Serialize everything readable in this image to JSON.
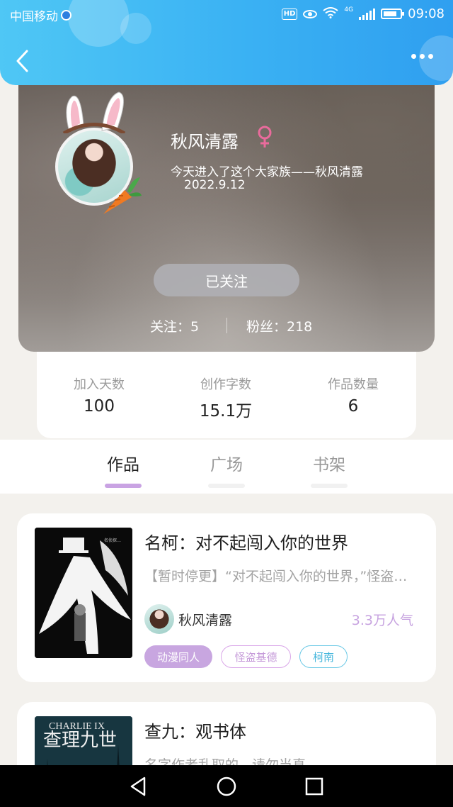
{
  "status_bar": {
    "carrier": "中国移动",
    "hd_label": "HD",
    "network_label": "4G",
    "time": "09:08"
  },
  "header": {
    "back_icon": "chevron-left-icon",
    "more_icon": "more-dots-icon"
  },
  "profile": {
    "nickname": "秋风清露",
    "gender_symbol": "♀",
    "bio": "今天进入了这个大家族——秋风清露",
    "bio_date": "2022.9.12",
    "follow_label": "已关注",
    "following_text": "关注：5",
    "fans_text": "粉丝：218"
  },
  "stats": [
    {
      "label": "加入天数",
      "value": "100"
    },
    {
      "label": "创作字数",
      "value": "15.1万"
    },
    {
      "label": "作品数量",
      "value": "6"
    }
  ],
  "tabs": [
    {
      "label": "作品",
      "active": true
    },
    {
      "label": "广场",
      "active": false
    },
    {
      "label": "书架",
      "active": false
    }
  ],
  "works": [
    {
      "title": "名柯：对不起闯入你的世界",
      "description": "【暂时停更】“对不起闯入你的世界，”怪盗基德……",
      "author": "秋风清露",
      "popularity": "3.3万人气",
      "tags": [
        "动漫同人",
        "怪盗基德",
        "柯南"
      ]
    },
    {
      "title": "查九：观书体",
      "description": "名字作者乱取的，请勿当真"
    }
  ],
  "colors": {
    "header_gradient_start": "#4fc7f5",
    "header_gradient_end": "#2f9ff0",
    "accent_purple": "#c8a6e0",
    "tag_cyan": "#44b6dc",
    "gender_pink": "#e96b9c"
  }
}
